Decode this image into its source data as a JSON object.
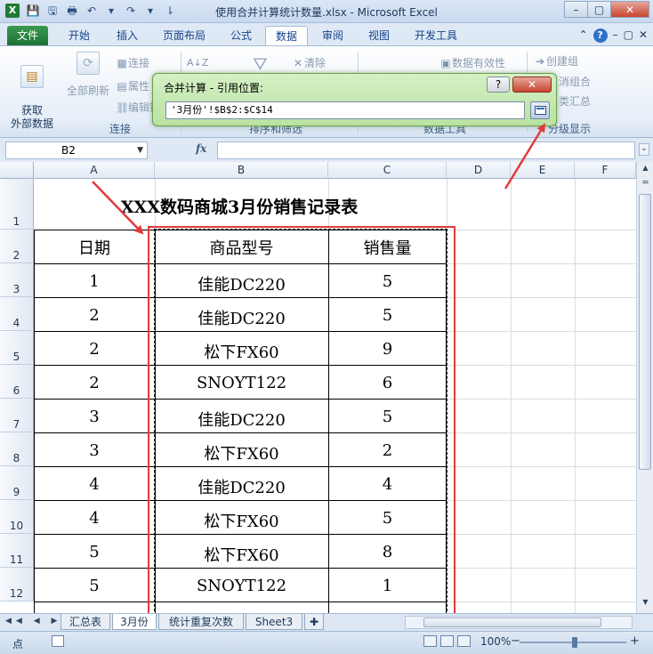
{
  "window": {
    "title": "使用合并计算统计数量.xlsx - Microsoft Excel",
    "app_icon": "X",
    "controls": [
      "–",
      "▢",
      "✕"
    ]
  },
  "qat": [
    "💾",
    "🖫",
    "🖶",
    "↶",
    "▾",
    "↷",
    "▾",
    "⇂"
  ],
  "tabs": [
    {
      "label": "文件"
    },
    {
      "label": "开始"
    },
    {
      "label": "插入"
    },
    {
      "label": "页面布局"
    },
    {
      "label": "公式"
    },
    {
      "label": "数据"
    },
    {
      "label": "审阅"
    },
    {
      "label": "视图"
    },
    {
      "label": "开发工具"
    }
  ],
  "tab_right": [
    "⌃",
    "?",
    "–",
    "▢",
    "✕"
  ],
  "ribbon": {
    "get_external": "获取\n外部数据",
    "refresh_all": "全部刷新",
    "connections": "连接",
    "properties": "属性",
    "edit_links": "编辑链",
    "group_connections": "连接",
    "sort_az": "A↓Z",
    "filter_clear": "清除",
    "group_sort": "排序和筛选",
    "data_validation": "数据有效性",
    "group_tools": "数据工具",
    "create_group": "创建组",
    "ungroup": "消组合",
    "subtotal": "类汇总",
    "group_outline": "分级显示"
  },
  "dialog": {
    "title": "合并计算 - 引用位置:",
    "help": "?",
    "close": "✕",
    "reference": "'3月份'!$B$2:$C$14"
  },
  "formula_bar": {
    "name_box": "B2",
    "fx": "fx",
    "formula": ""
  },
  "columns": [
    "A",
    "B",
    "C",
    "D",
    "E",
    "F"
  ],
  "rows": [
    "1",
    "2",
    "3",
    "4",
    "5",
    "6",
    "7",
    "8",
    "9",
    "10",
    "11",
    "12"
  ],
  "sheet": {
    "title": "XXX数码商城3月份销售记录表",
    "headers": [
      "日期",
      "商品型号",
      "销售量"
    ],
    "data": [
      [
        "1",
        "佳能DC220",
        "5"
      ],
      [
        "2",
        "佳能DC220",
        "5"
      ],
      [
        "2",
        "松下FX60",
        "9"
      ],
      [
        "2",
        "SNOYT122",
        "6"
      ],
      [
        "3",
        "佳能DC220",
        "5"
      ],
      [
        "3",
        "松下FX60",
        "2"
      ],
      [
        "4",
        "佳能DC220",
        "4"
      ],
      [
        "4",
        "松下FX60",
        "5"
      ],
      [
        "5",
        "松下FX60",
        "8"
      ],
      [
        "5",
        "SNOYT122",
        "1"
      ]
    ]
  },
  "sheet_tabs": [
    "汇总表",
    "3月份",
    "统计重复次数",
    "Sheet3"
  ],
  "sheet_nav": "◀◀ ◀ ▶ ▶▶",
  "status": {
    "mode": "点",
    "zoom": "100%",
    "zoom_minus": "−",
    "zoom_plus": "+"
  },
  "colors": {
    "accent": "#1d7235",
    "highlight": "#e23a3a"
  }
}
